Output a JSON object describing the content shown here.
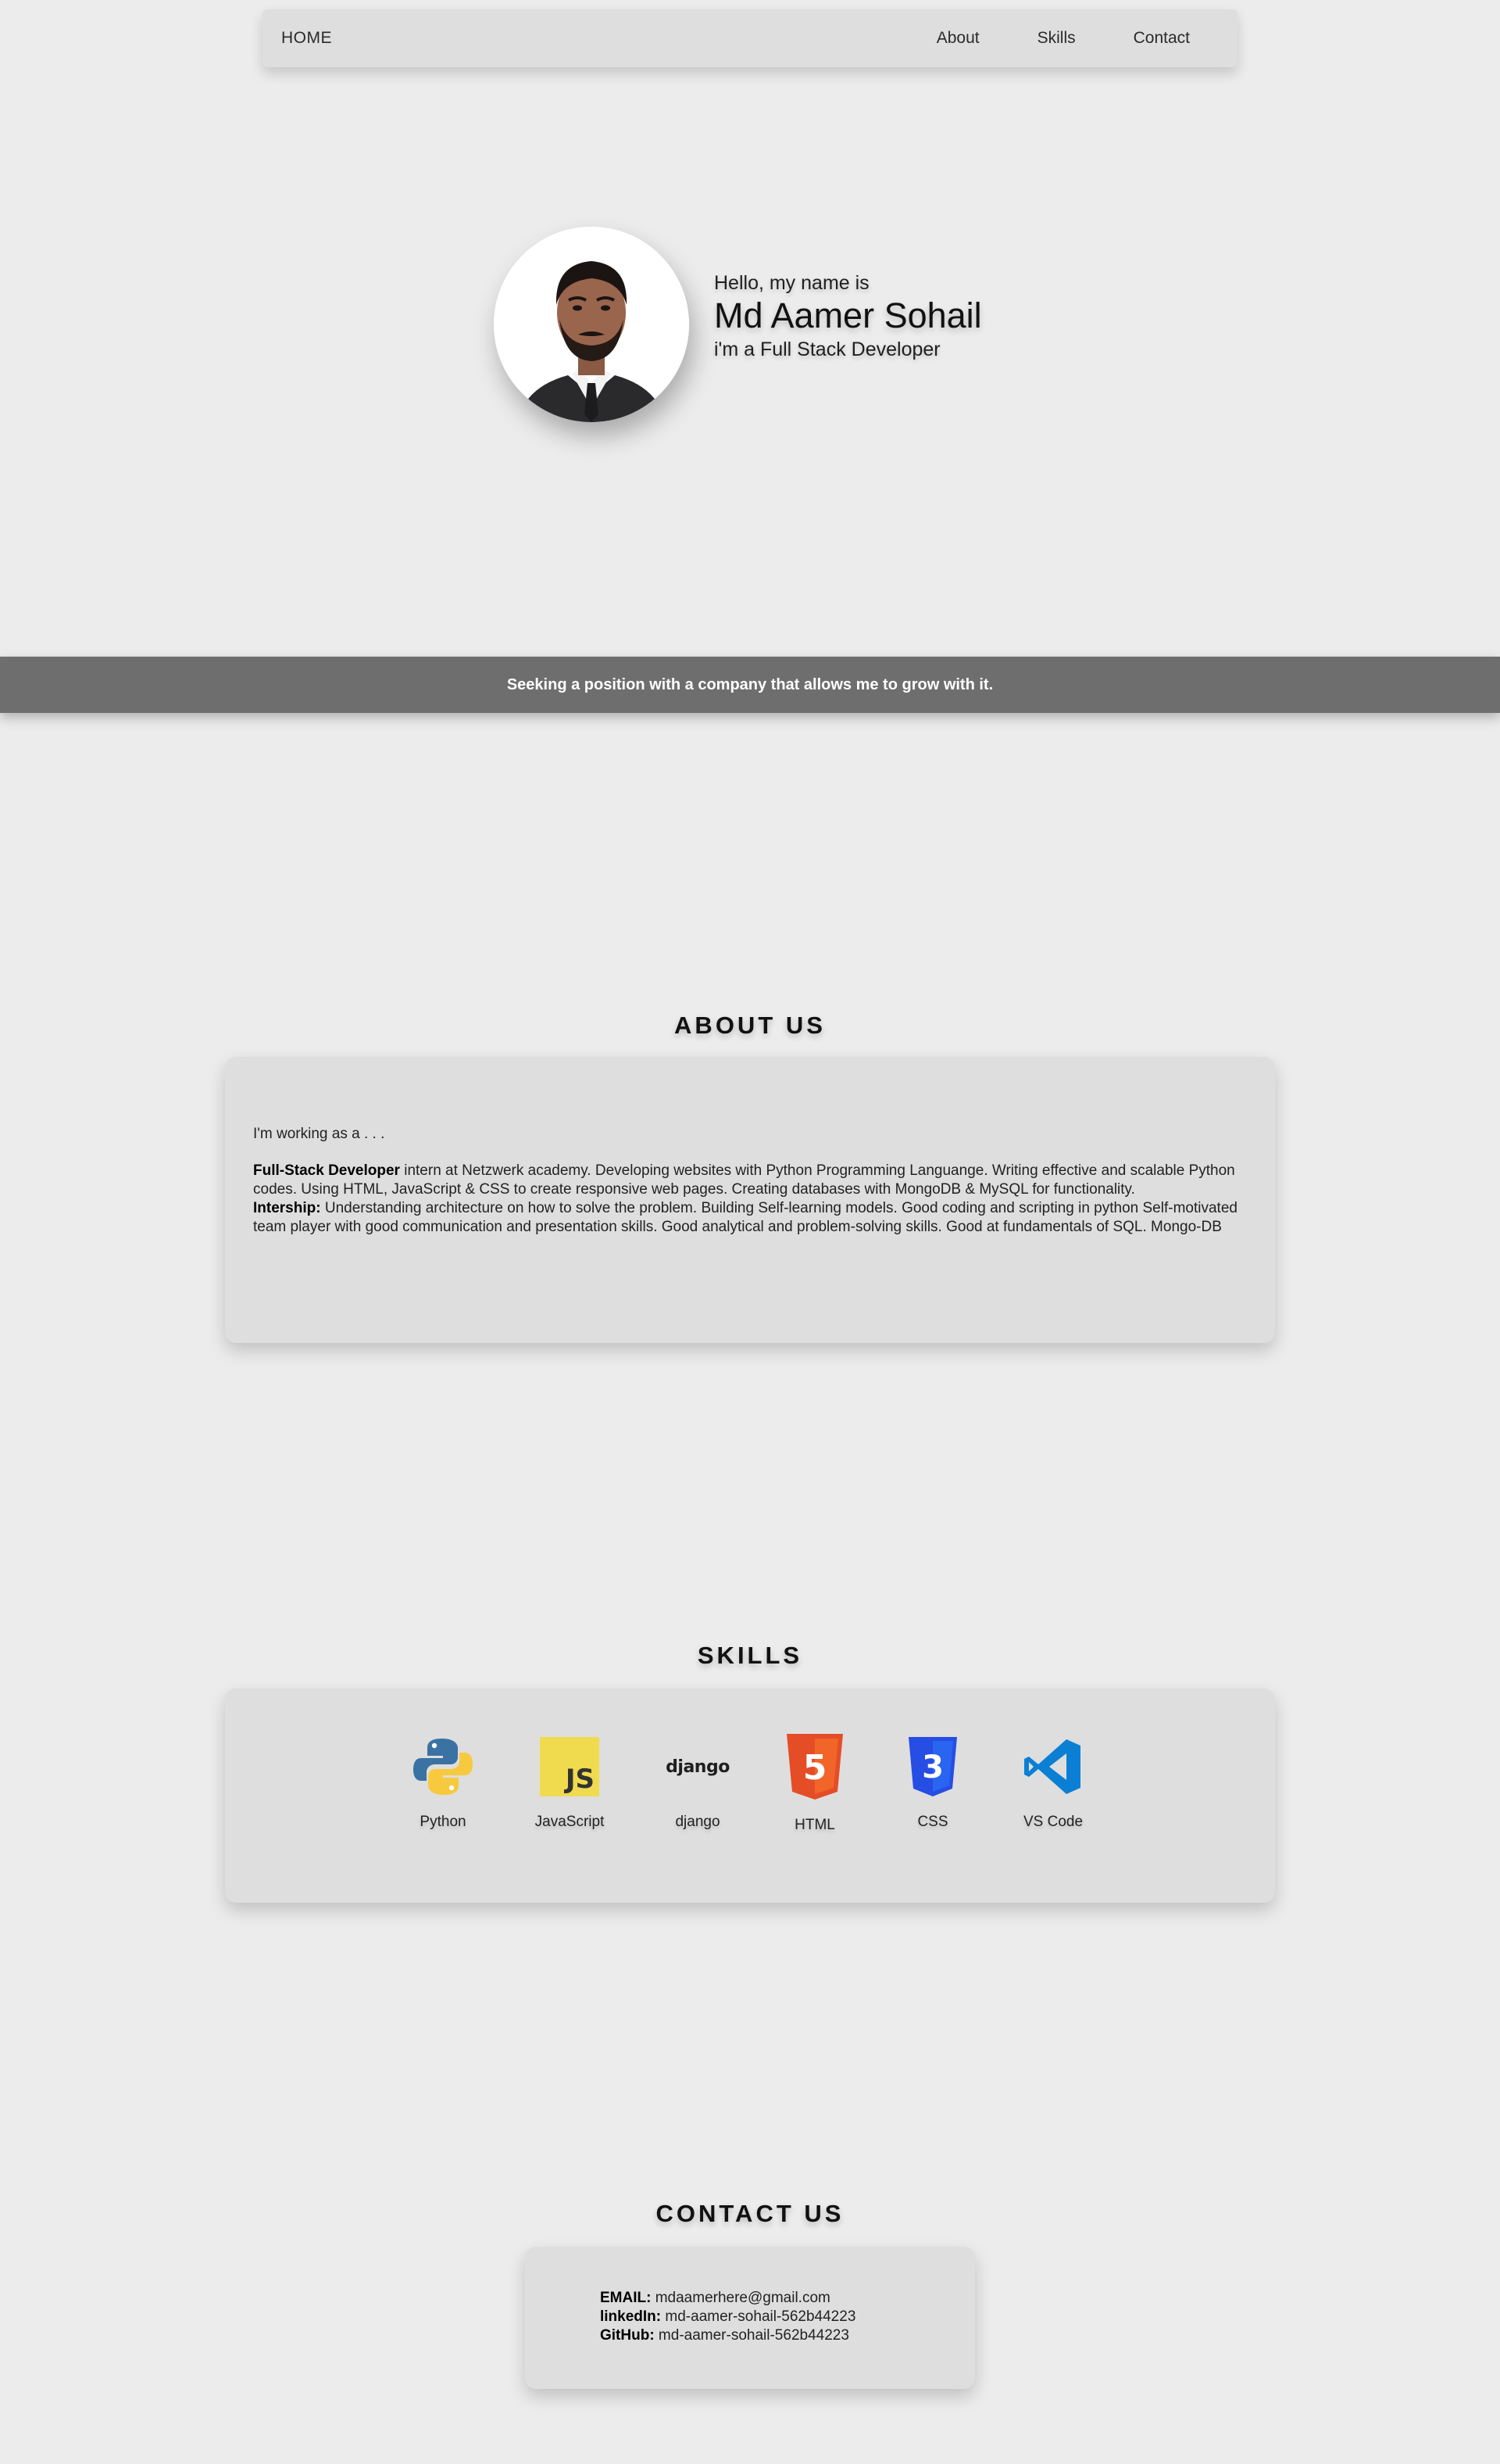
{
  "nav": {
    "home_label": "HOME",
    "links": [
      {
        "label": "About"
      },
      {
        "label": "Skills"
      },
      {
        "label": "Contact"
      }
    ]
  },
  "hero": {
    "greeting": "Hello, my name is",
    "name": "Md Aamer Sohail",
    "role": "i'm a Full Stack Developer"
  },
  "banner": {
    "text": "Seeking a position with a company that allows me to grow with it."
  },
  "about": {
    "title": "ABOUT US",
    "intro": "I'm working as a . . .",
    "fullstack_label": "Full-Stack Developer",
    "fullstack_text": " intern at Netzwerk academy. Developing websites with Python Programming Languange. Writing effective and scalable Python codes. Using HTML, JavaScript & CSS to create responsive web pages. Creating databases with MongoDB & MySQL for functionality.",
    "internship_label": "Intership:",
    "internship_text": " Understanding architecture on how to solve the problem. Building Self-learning models. Good coding and scripting in python Self-motivated team player with good communication and presentation skills. Good analytical and problem-solving skills. Good at fundamentals of SQL. Mongo-DB"
  },
  "skills": {
    "title": "SKILLS",
    "items": [
      {
        "label": "Python",
        "icon": "python-icon"
      },
      {
        "label": "JavaScript",
        "icon": "javascript-icon",
        "icon_text": "JS"
      },
      {
        "label": "django",
        "icon": "django-icon",
        "icon_text": "django"
      },
      {
        "label": "HTML",
        "icon": "html5-icon",
        "icon_text": "5"
      },
      {
        "label": "CSS",
        "icon": "css3-icon",
        "icon_text": "3"
      },
      {
        "label": "VS Code",
        "icon": "vscode-icon"
      }
    ]
  },
  "contact": {
    "title": "CONTACT US",
    "email_label": "EMAIL:",
    "email_value": " mdaamerhere@gmail.com",
    "linkedin_label": "linkedIn:",
    "linkedin_value": " md-aamer-sohail-562b44223",
    "github_label": "GitHub:",
    "github_value": " md-aamer-sohail-562b44223"
  },
  "colors": {
    "background": "#ececec",
    "card": "#dedede",
    "banner": "#6e6e6e",
    "python_blue": "#3a72a4",
    "python_yellow": "#f7c93e",
    "js_yellow": "#f0db4f",
    "html_orange": "#e44d26",
    "css_blue": "#264de4",
    "vscode_blue": "#0a7fd4"
  }
}
